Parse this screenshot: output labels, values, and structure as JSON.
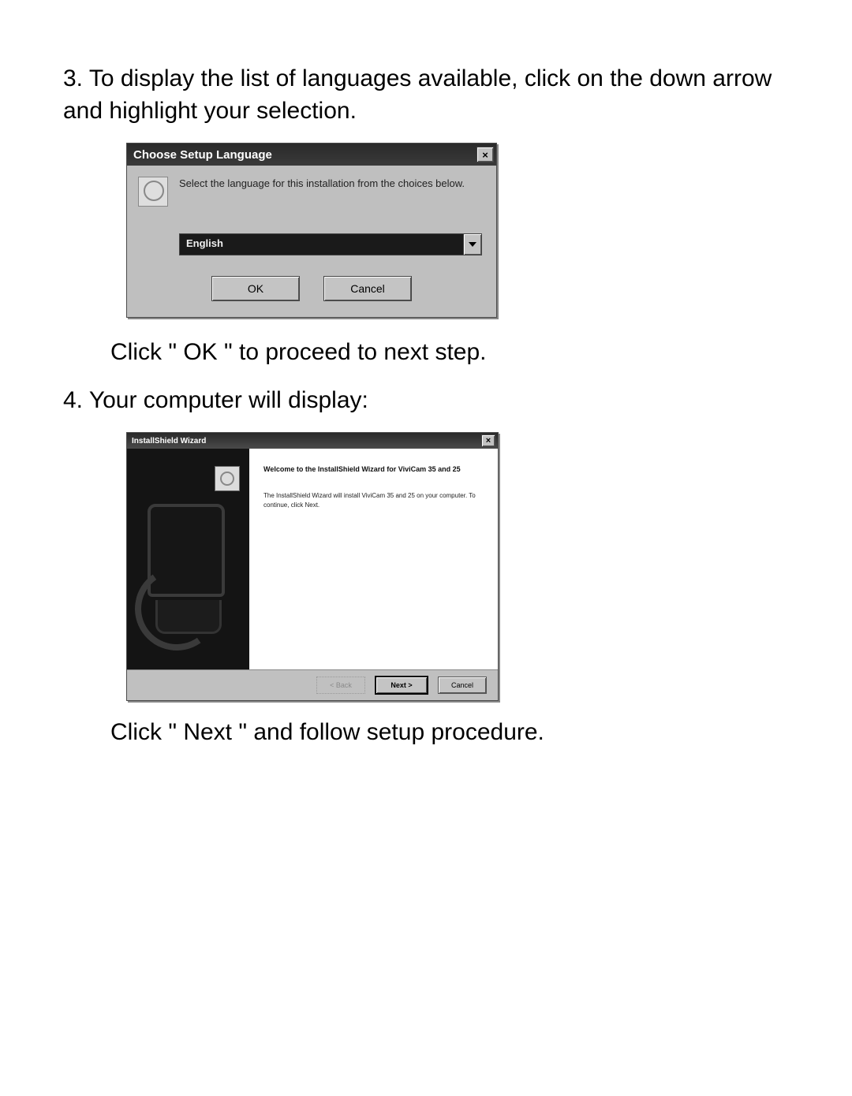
{
  "step3": {
    "text": "3. To display the list of languages available, click on the down arrow and highlight your selection.",
    "after": "Click \" OK \" to proceed to next step."
  },
  "step4": {
    "text": "4. Your computer will display:",
    "after": "Click \" Next \" and follow setup procedure."
  },
  "dialog1": {
    "title": "Choose Setup Language",
    "close_glyph": "×",
    "message": "Select the language for this installation from the choices below.",
    "selected_language": "English",
    "ok": "OK",
    "cancel": "Cancel"
  },
  "dialog2": {
    "title": "InstallShield Wizard",
    "close_glyph": "×",
    "heading": "Welcome to the InstallShield Wizard for ViviCam 35 and 25",
    "body": "The InstallShield Wizard will install ViviCam 35 and 25 on your computer. To continue, click Next.",
    "back": "< Back",
    "next": "Next >",
    "cancel": "Cancel"
  }
}
